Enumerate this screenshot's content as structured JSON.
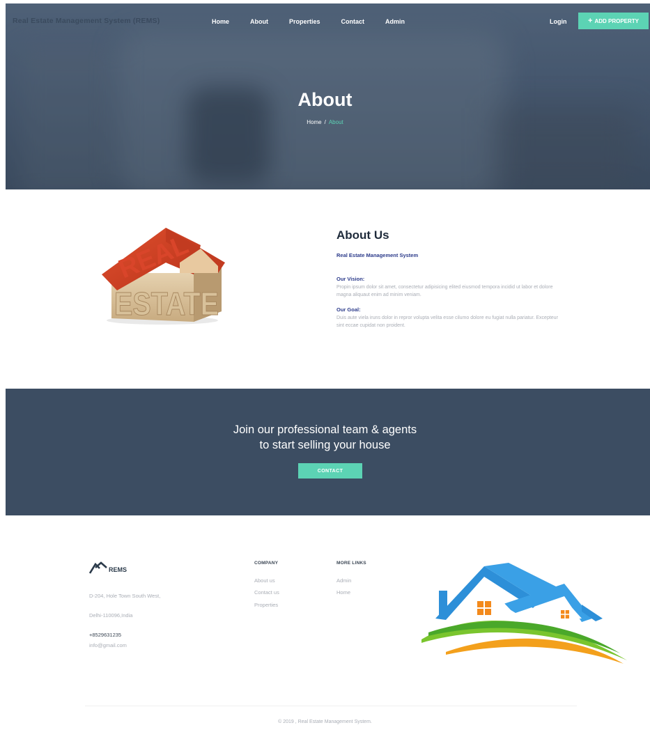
{
  "nav": {
    "brand": "Real Estate Management System (REMS)",
    "links": [
      "Home",
      "About",
      "Properties",
      "Contact",
      "Admin"
    ],
    "login": "Login",
    "add_property": "ADD PROPERTY"
  },
  "hero": {
    "title": "About",
    "breadcrumb": {
      "home": "Home",
      "separator": "/",
      "current": "About"
    }
  },
  "about": {
    "image_text": [
      "REAL",
      "ESTATE"
    ],
    "title": "About Us",
    "subtitle": "Real Estate Management System",
    "vision_label": "Our Vision:",
    "vision_text": "Propin ipsum dolor sit amet, consectetur adipisicing elited eiusmod tempora incidid ut labor et dolore magna aliquaut enim ad minim veniam.",
    "goal_label": "Our Goal:",
    "goal_text": "Duis aute viela iruns dolor in repror volupta velita esse cilumo dolore eu fugiat nulla pariatur. Excepteur sint eccae cupidat non proident."
  },
  "cta": {
    "line1": "Join our professional team & agents",
    "line2": "to start selling your house",
    "button": "CONTACT"
  },
  "footer": {
    "logo_text": "REMS",
    "address_line1": "D-204, Hole Town South West,",
    "address_line2": "Delhi-110096,India",
    "phone": "+8529631235",
    "email": "info@gmail.com",
    "company_heading": "COMPANY",
    "company_links": [
      "About us",
      "Contact us",
      "Properties"
    ],
    "more_heading": "MORE LINKS",
    "more_links": [
      "Admin",
      "Home"
    ],
    "copyright": "© 2019 , Real Estate Management System."
  },
  "colors": {
    "accent": "#5cd3b4",
    "cta_bg": "#3c4d62",
    "heading_blue": "#2b3a8a"
  }
}
